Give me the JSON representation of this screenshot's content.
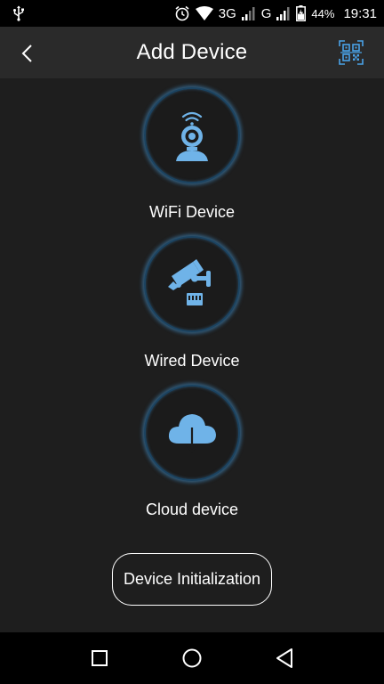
{
  "status_bar": {
    "network": "3G",
    "network2": "G",
    "battery": "44%",
    "time": "19:31"
  },
  "header": {
    "title": "Add Device"
  },
  "options": [
    {
      "label": "WiFi Device",
      "icon": "wifi-camera-icon"
    },
    {
      "label": "Wired Device",
      "icon": "wired-camera-icon"
    },
    {
      "label": "Cloud device",
      "icon": "cloud-download-icon"
    }
  ],
  "init_button": {
    "label": "Device Initialization"
  },
  "colors": {
    "accent": "#6fb3e8",
    "background": "#1e1e1e",
    "header": "#2a2a2a"
  }
}
